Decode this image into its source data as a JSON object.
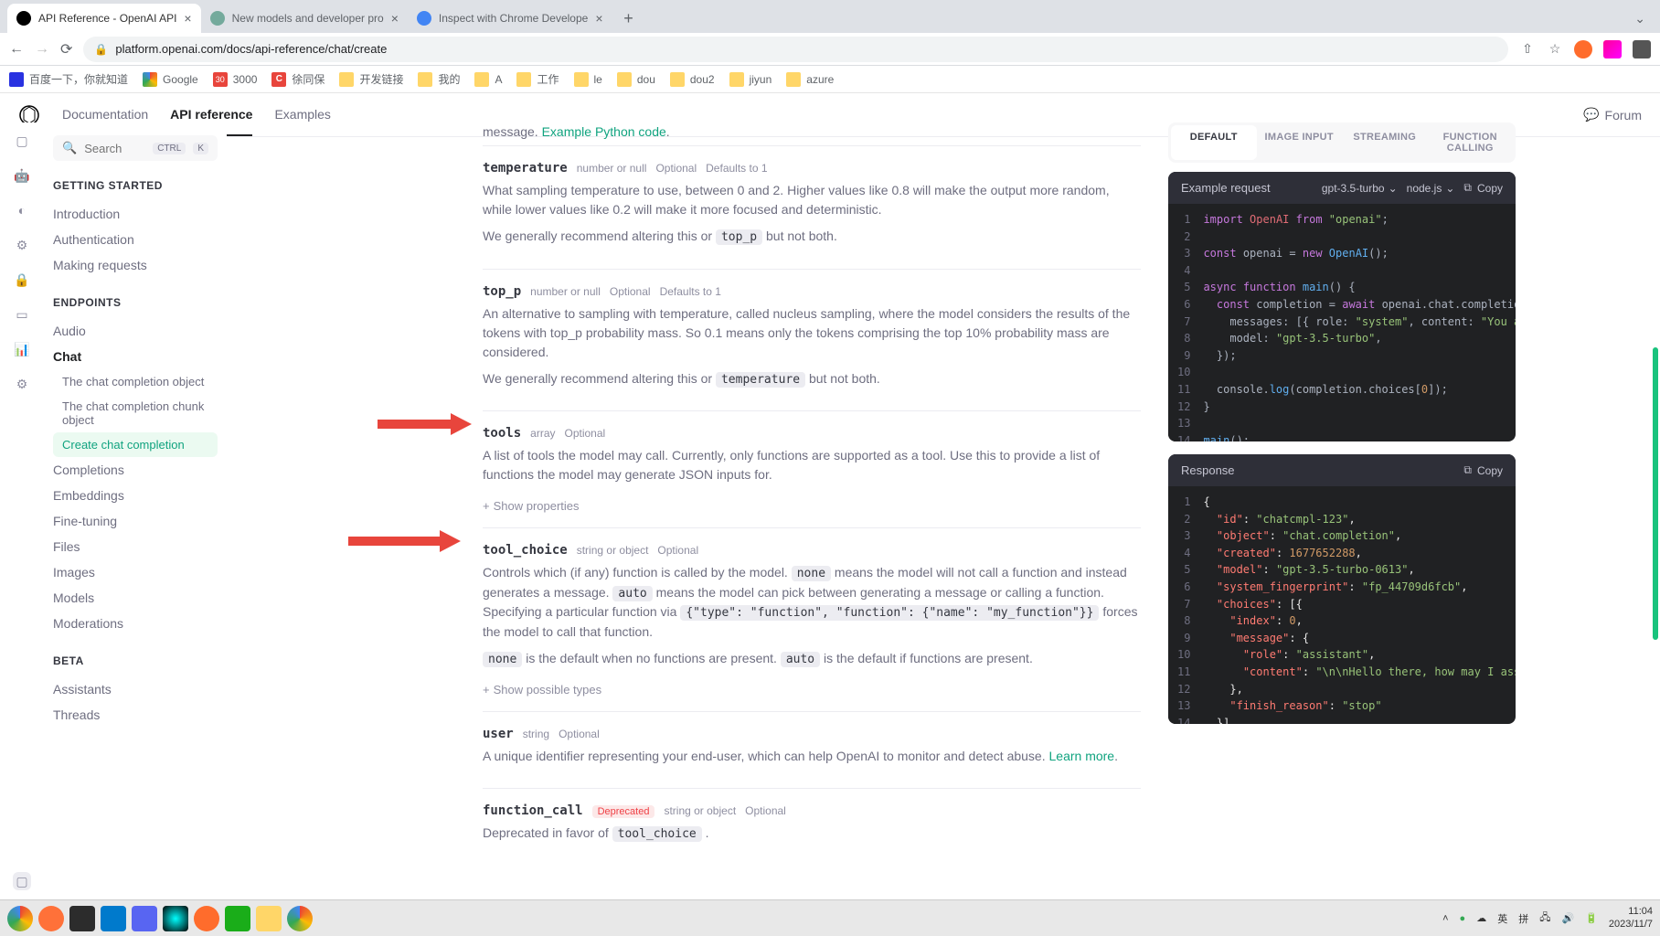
{
  "browser": {
    "tabs": [
      {
        "title": "API Reference - OpenAI API",
        "active": true
      },
      {
        "title": "New models and developer pro",
        "active": false
      },
      {
        "title": "Inspect with Chrome Develope",
        "active": false
      }
    ],
    "url": "platform.openai.com/docs/api-reference/chat/create",
    "bookmarks": [
      "百度一下，你就知道",
      "Google",
      "3000",
      "徐同保",
      "开发链接",
      "我的",
      "A",
      "工作",
      "le",
      "dou",
      "dou2",
      "jiyun",
      "azure"
    ]
  },
  "header": {
    "navs": [
      "Documentation",
      "API reference",
      "Examples"
    ],
    "active_nav": "API reference",
    "forum": "Forum"
  },
  "sidebar": {
    "search_placeholder": "Search",
    "kbd1": "CTRL",
    "kbd2": "K",
    "sections": [
      {
        "title": "GETTING STARTED",
        "items": [
          "Introduction",
          "Authentication",
          "Making requests"
        ]
      },
      {
        "title": "ENDPOINTS",
        "items": [
          "Audio",
          "Chat",
          "Completions",
          "Embeddings",
          "Fine-tuning",
          "Files",
          "Images",
          "Models",
          "Moderations"
        ]
      },
      {
        "title": "BETA",
        "items": [
          "Assistants",
          "Threads"
        ]
      }
    ],
    "chat_sub": [
      "The chat completion object",
      "The chat completion chunk object",
      "Create chat completion"
    ],
    "chat_active": "Create chat completion"
  },
  "content": {
    "lead_trail": "message. ",
    "lead_link": "Example Python code",
    "params": {
      "temperature": {
        "name": "temperature",
        "type": "number or null",
        "optional": "Optional",
        "default": "Defaults to 1",
        "desc1": "What sampling temperature to use, between 0 and 2. Higher values like 0.8 will make the output more random, while lower values like 0.2 will make it more focused and deterministic.",
        "desc2a": "We generally recommend altering this or ",
        "desc2_code": "top_p",
        "desc2b": " but not both."
      },
      "top_p": {
        "name": "top_p",
        "type": "number or null",
        "optional": "Optional",
        "default": "Defaults to 1",
        "desc1": "An alternative to sampling with temperature, called nucleus sampling, where the model considers the results of the tokens with top_p probability mass. So 0.1 means only the tokens comprising the top 10% probability mass are considered.",
        "desc2a": "We generally recommend altering this or ",
        "desc2_code": "temperature",
        "desc2b": " but not both."
      },
      "tools": {
        "name": "tools",
        "type": "array",
        "optional": "Optional",
        "desc": "A list of tools the model may call. Currently, only functions are supported as a tool. Use this to provide a list of functions the model may generate JSON inputs for.",
        "expand": "Show properties"
      },
      "tool_choice": {
        "name": "tool_choice",
        "type": "string or object",
        "optional": "Optional",
        "desc1a": "Controls which (if any) function is called by the model. ",
        "desc1_code1": "none",
        "desc1b": " means the model will not call a function and instead generates a message. ",
        "desc1_code2": "auto",
        "desc1c": " means the model can pick between generating a message or calling a function. Specifying a particular function via ",
        "desc1_code3": "{\"type\": \"function\", \"function\": {\"name\": \"my_function\"}}",
        "desc1d": " forces the model to call that function.",
        "desc2_code1": "none",
        "desc2a": " is the default when no functions are present. ",
        "desc2_code2": "auto",
        "desc2b": " is the default if functions are present.",
        "expand": "Show possible types"
      },
      "user": {
        "name": "user",
        "type": "string",
        "optional": "Optional",
        "desc": "A unique identifier representing your end-user, which can help OpenAI to monitor and detect abuse. ",
        "link": "Learn more"
      },
      "function_call": {
        "name": "function_call",
        "deprecated": "Deprecated",
        "type": "string or object",
        "optional": "Optional",
        "desc": "Deprecated in favor of ",
        "code": "tool_choice"
      }
    }
  },
  "code": {
    "tabs": [
      "DEFAULT",
      "IMAGE INPUT",
      "STREAMING",
      "FUNCTION CALLING"
    ],
    "request_title": "Example request",
    "dd_model": "gpt-3.5-turbo",
    "dd_lang": "node.js",
    "copy": "Copy",
    "response_title": "Response",
    "request_lines": 14,
    "response_lines": 15
  },
  "taskbar": {
    "lang1": "英",
    "lang2": "拼",
    "time": "11:04",
    "date": "2023/11/7"
  }
}
